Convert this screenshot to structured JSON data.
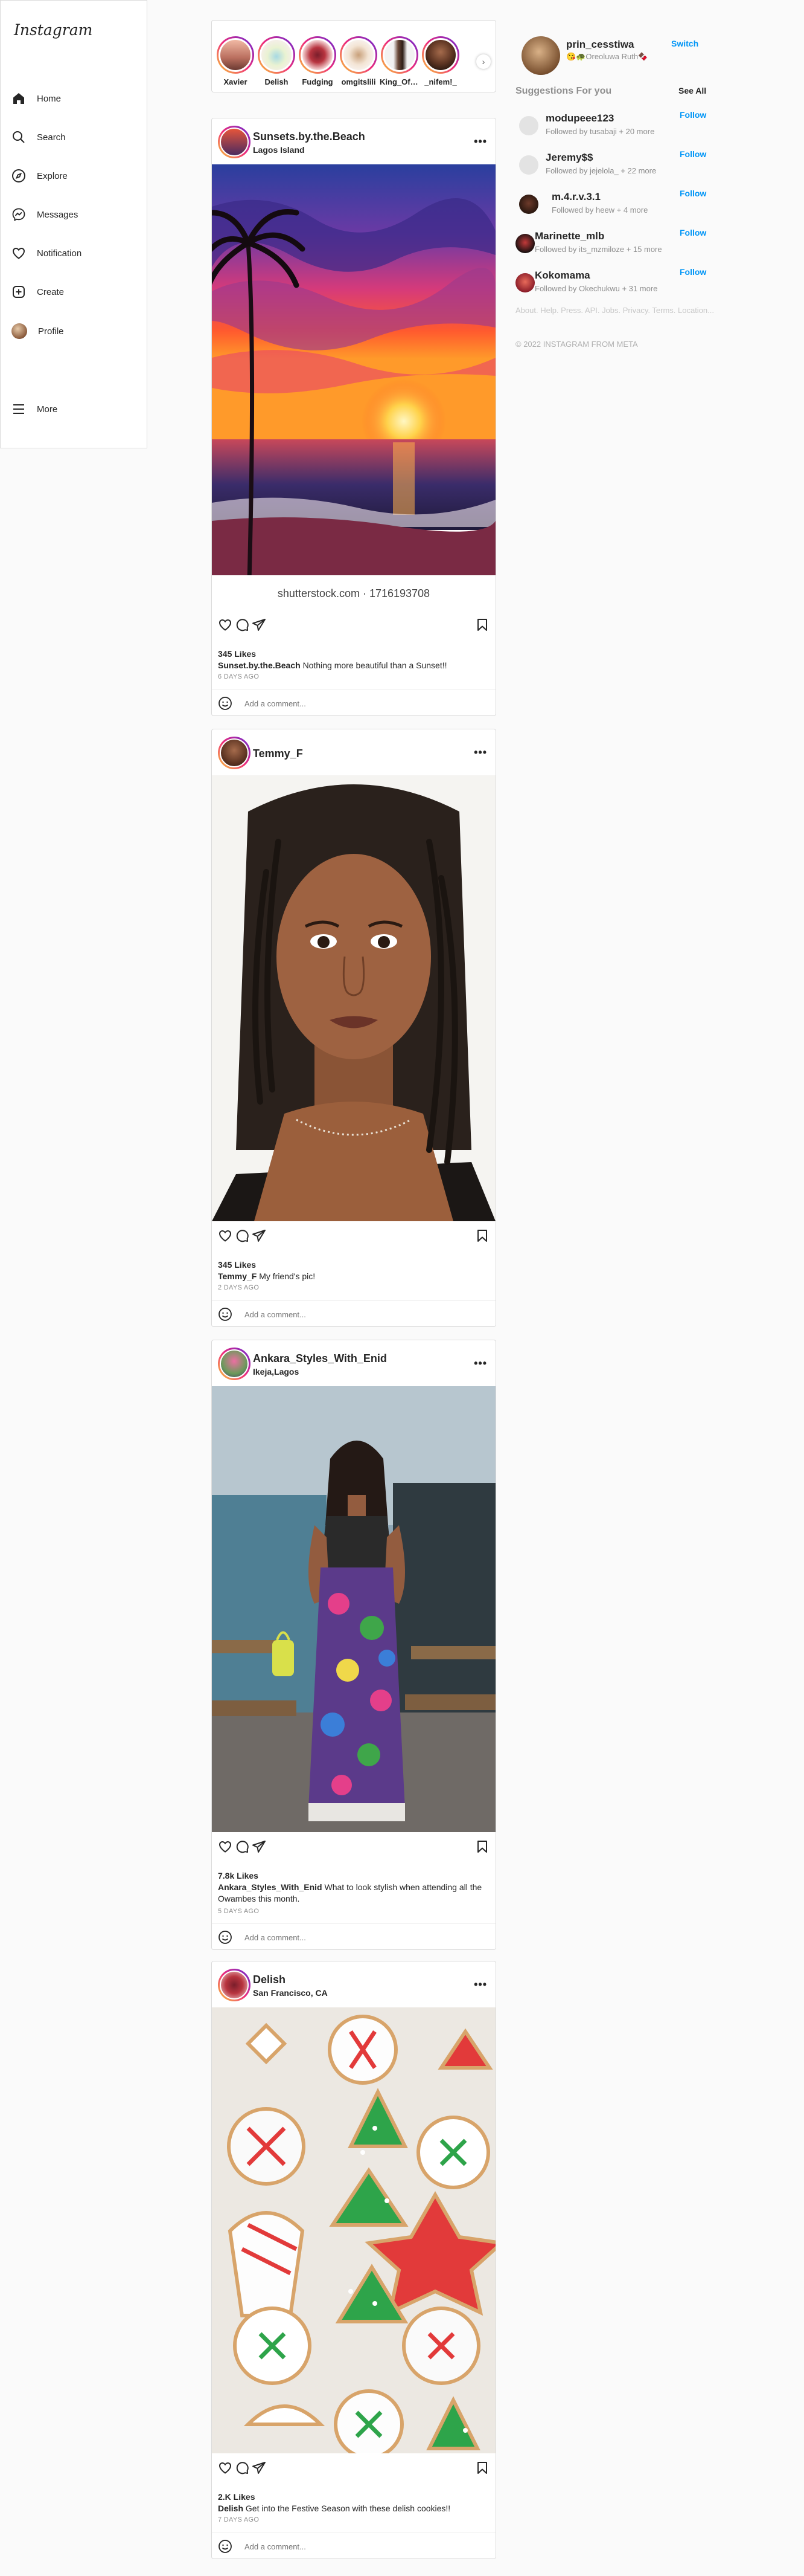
{
  "app": {
    "logo": "Instagram"
  },
  "sidebar": {
    "items": [
      {
        "label": "Home",
        "icon": "home-icon"
      },
      {
        "label": "Search",
        "icon": "search-icon"
      },
      {
        "label": "Explore",
        "icon": "compass-icon"
      },
      {
        "label": "Messages",
        "icon": "messenger-icon"
      },
      {
        "label": "Notification",
        "icon": "heart-icon"
      },
      {
        "label": "Create",
        "icon": "plus-square-icon"
      },
      {
        "label": "Profile",
        "icon": "avatar"
      }
    ],
    "more_label": "More"
  },
  "stories": [
    {
      "name": "Xavier"
    },
    {
      "name": "Delish"
    },
    {
      "name": "Fudging"
    },
    {
      "name": "omgitslili"
    },
    {
      "name": "King_Of_H"
    },
    {
      "name": "_nifem!_"
    }
  ],
  "posts": [
    {
      "user": "Sunsets.by.the.Beach",
      "location": "Lagos Island",
      "watermark": "shutterstock.com · 1716193708",
      "likes": "345 Likes",
      "caption_user": "Sunset.by.the.Beach",
      "caption_text": "Nothing more beautiful than a Sunset!!",
      "ago": "6 DAYS AGO",
      "comment_placeholder": "Add a comment..."
    },
    {
      "user": "Temmy_F",
      "location": "",
      "likes": "345 Likes",
      "caption_user": "Temmy_F",
      "caption_text": "My friend's pic!",
      "ago": "2 DAYS AGO",
      "comment_placeholder": "Add a comment..."
    },
    {
      "user": "Ankara_Styles_With_Enid",
      "location": "Ikeja,Lagos",
      "likes": "7.8k Likes",
      "caption_user": "Ankara_Styles_With_Enid",
      "caption_text": "What to look stylish when attending all the Owambes this month.",
      "ago": "5 DAYS AGO",
      "comment_placeholder": "Add a comment..."
    },
    {
      "user": "Delish",
      "location": "San Francisco, CA",
      "likes": "2.K Likes",
      "caption_user": "Delish",
      "caption_text": "Get into the Festive Season with these delish cookies!!",
      "ago": "7 DAYS AGO",
      "comment_placeholder": "Add a comment..."
    }
  ],
  "me": {
    "username": "prin_cesstiwa",
    "subtitle": "😘🐢Oreoluwa Ruth🍫",
    "switch_label": "Switch"
  },
  "suggestions": {
    "title": "Suggestions For you",
    "see_all": "See All",
    "items": [
      {
        "name": "modupeee123",
        "by": "Followed by tusabaji + 20 more",
        "follow": "Follow"
      },
      {
        "name": "Jeremy$$",
        "by": "Followed by jejelola_ + 22 more",
        "follow": "Follow"
      },
      {
        "name": "m.4.r.v.3.1",
        "by": "Followed by heew + 4 more",
        "follow": "Follow"
      },
      {
        "name": "Marinette_mlb",
        "by": "Followed by its_mzmiloze + 15 more",
        "follow": "Follow"
      },
      {
        "name": "Kokomama",
        "by": "Followed by Okechukwu + 31 more",
        "follow": "Follow"
      }
    ]
  },
  "footer": {
    "links": "About. Help. Press. API. Jobs. Privacy. Terms. Location...",
    "copyright": "© 2022 INSTAGRAM FROM META"
  }
}
